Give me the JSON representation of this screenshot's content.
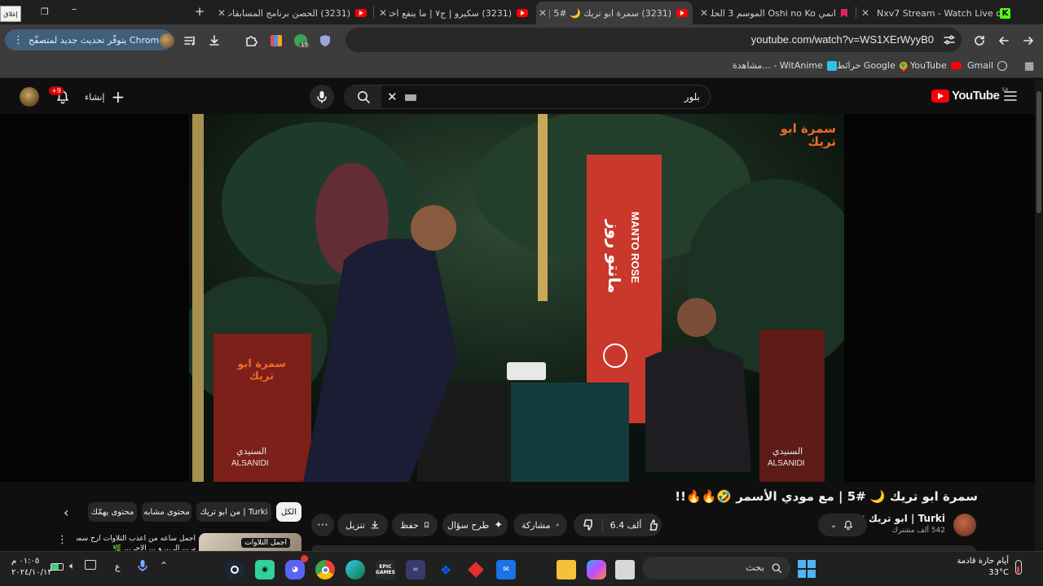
{
  "browser": {
    "tabs": [
      {
        "title": "Nxv7 Stream - Watch Live on Ki",
        "favicon": "kick-icon",
        "active": false
      },
      {
        "title": "انمي Oshi no Ko الموسم 3 الحلقة",
        "favicon": "bookmark-red-icon",
        "active": false
      },
      {
        "title": "(3231) سمرة ابو تريك 🌙 #5 | مع",
        "favicon": "youtube-icon",
        "active": true
      },
      {
        "title": "(3231) سكيرو | ج٧ | ما ينفع اختم",
        "favicon": "youtube-icon",
        "active": false
      },
      {
        "title": "(3231) الحصن برنامج المسابقات ا",
        "favicon": "youtube-icon",
        "active": false
      }
    ],
    "corner_label": "إغلاق",
    "url": "youtube.com/watch?v=WS1XErWyyB0",
    "update_button": "يتوفّر تحديث جديد لمتصفّح Chrome",
    "extension_badge": "15",
    "bookmarks": [
      {
        "label": "Gmail",
        "icon": "gmail-icon"
      },
      {
        "label": "YouTube",
        "icon": "youtube-icon"
      },
      {
        "label": "خرائط Google",
        "icon": "maps-icon"
      },
      {
        "label": "مشاهدة... - WitAnime",
        "icon": "witanime-icon"
      }
    ]
  },
  "youtube": {
    "logo": "YouTube",
    "country_code": "SA",
    "search_value": "بلور",
    "create_label": "إنشاء",
    "notification_badge": "+9",
    "video_title": "سمرة ابو تريك 🌙 #5 | مع مودي الأسمر 🤣🔥🔥!!",
    "channel_name": "Turki | ابو تريك",
    "subscribers": "542 ألف مشترك",
    "likes": "6.4 ألف",
    "share_label": "مشاركة",
    "ask_label": "طرح سؤال",
    "save_label": "حفظ",
    "download_label": "تنزيل",
    "chips": [
      "الكل",
      "من ابو تريك | Turki",
      "محتوى مشابه",
      "محتوى يهمّك"
    ],
    "up_next_title": "اجمل ساعه من اعذب التلاوات ارح سمعك",
    "up_next_sub": "بـ ... الـ ... و ... الأحـ ... 🌿",
    "up_next_thumb_text": "اجمل التلاوات",
    "video_overlay": {
      "logo": "سمرة ابو تريك",
      "banner_ar": "مانتو روز",
      "banner_en": "MANTO ROSE",
      "sponsor_ar": "السنيدي",
      "sponsor_en": "ALSANIDI"
    }
  },
  "taskbar": {
    "weather_title": "أيام حارة قادمة",
    "weather_temp": "33°C",
    "search_placeholder": "بحث",
    "time": "٠١:٠٥ م",
    "date": "٢٠٢٤/١٠/١٣",
    "lang": "ع",
    "apps": [
      "windows-icon",
      "weather-widget",
      "store-icon",
      "file-explorer-icon",
      "copilot-icon",
      "mail-icon",
      "cube-icon",
      "dropbox-icon",
      "visual-studio-icon",
      "epic-games-icon",
      "edge-icon",
      "chrome-icon",
      "discord-icon",
      "ubisoft-icon",
      "steam-icon"
    ]
  }
}
